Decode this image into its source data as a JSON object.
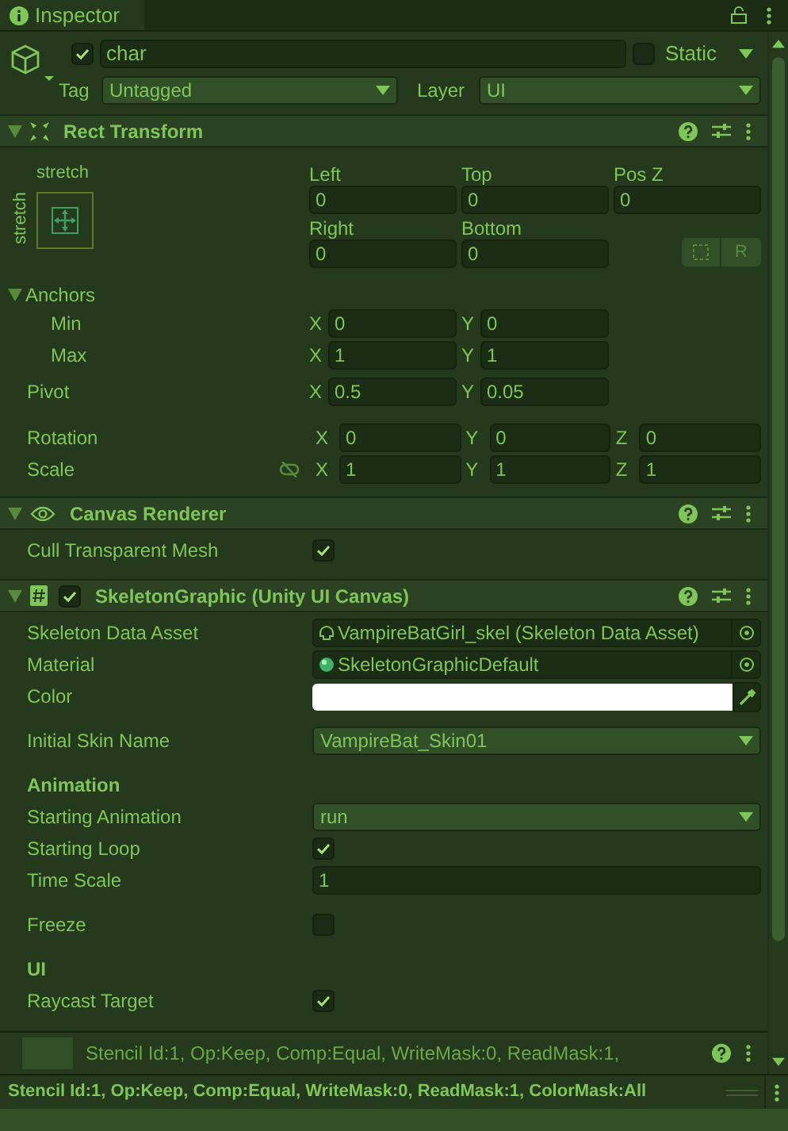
{
  "tab": {
    "title": "Inspector"
  },
  "object": {
    "active": true,
    "name": "char",
    "static": false,
    "static_label": "Static",
    "tag_label": "Tag",
    "tag": "Untagged",
    "layer_label": "Layer",
    "layer": "UI"
  },
  "rect_transform": {
    "title": "Rect Transform",
    "expanded": true,
    "anchor_preset": {
      "horizontal": "stretch",
      "vertical": "stretch"
    },
    "position_fields": [
      {
        "label": "Left",
        "value": "0"
      },
      {
        "label": "Top",
        "value": "0"
      },
      {
        "label": "Pos Z",
        "value": "0"
      },
      {
        "label": "Right",
        "value": "0"
      },
      {
        "label": "Bottom",
        "value": "0"
      }
    ],
    "raw_button": "R",
    "anchors": {
      "label": "Anchors",
      "expanded": true,
      "rows": [
        {
          "label": "Min",
          "fields": [
            {
              "axis": "X",
              "value": "0"
            },
            {
              "axis": "Y",
              "value": "0"
            }
          ]
        },
        {
          "label": "Max",
          "fields": [
            {
              "axis": "X",
              "value": "1"
            },
            {
              "axis": "Y",
              "value": "1"
            }
          ]
        }
      ]
    },
    "pivot": {
      "label": "Pivot",
      "fields": [
        {
          "axis": "X",
          "value": "0.5"
        },
        {
          "axis": "Y",
          "value": "0.05"
        }
      ]
    },
    "rotation": {
      "label": "Rotation",
      "fields": [
        {
          "axis": "X",
          "value": "0"
        },
        {
          "axis": "Y",
          "value": "0"
        },
        {
          "axis": "Z",
          "value": "0"
        }
      ]
    },
    "scale": {
      "label": "Scale",
      "constrained": false,
      "fields": [
        {
          "axis": "X",
          "value": "1"
        },
        {
          "axis": "Y",
          "value": "1"
        },
        {
          "axis": "Z",
          "value": "1"
        }
      ]
    }
  },
  "canvas_renderer": {
    "title": "Canvas Renderer",
    "expanded": true,
    "properties": [
      {
        "kind": "checkbox",
        "label": "Cull Transparent Mesh",
        "checked": true
      }
    ]
  },
  "skeleton_graphic": {
    "title": "SkeletonGraphic (Unity UI Canvas)",
    "enabled": true,
    "expanded": true,
    "properties": [
      {
        "kind": "object",
        "label": "Skeleton Data Asset",
        "value": "VampireBatGirl_skel (Skeleton Data Asset)"
      },
      {
        "kind": "object",
        "label": "Material",
        "value": "SkeletonGraphicDefault"
      },
      {
        "kind": "color",
        "label": "Color",
        "color": "#ffffff"
      },
      {
        "kind": "dropdown",
        "label": "Initial Skin Name",
        "value": "VampireBat_Skin01"
      },
      {
        "kind": "heading",
        "label": "Animation"
      },
      {
        "kind": "dropdown",
        "label": "Starting Animation",
        "value": "run"
      },
      {
        "kind": "checkbox",
        "label": "Starting Loop",
        "checked": true
      },
      {
        "kind": "text",
        "label": "Time Scale",
        "value": "1"
      },
      {
        "kind": "checkbox",
        "label": "Freeze",
        "checked": false
      },
      {
        "kind": "heading",
        "label": "UI"
      },
      {
        "kind": "checkbox",
        "label": "Raycast Target",
        "checked": true
      }
    ]
  },
  "material_preview": {
    "title": "Stencil Id:1, Op:Keep, Comp:Equal, WriteMask:0, ReadMask:1,"
  },
  "status_bar": {
    "text": "Stencil Id:1, Op:Keep, Comp:Equal, WriteMask:0, ReadMask:1, ColorMask:All"
  }
}
